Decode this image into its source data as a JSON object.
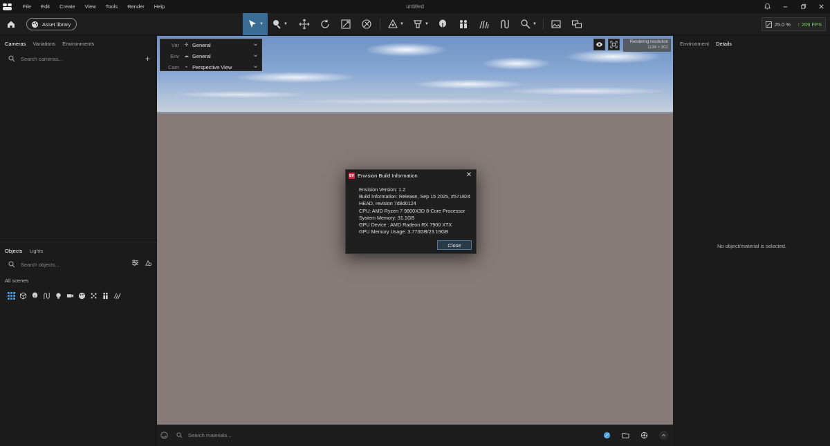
{
  "window": {
    "title": "untitled"
  },
  "menu": [
    "File",
    "Edit",
    "Create",
    "View",
    "Tools",
    "Render",
    "Help"
  ],
  "toolbar": {
    "asset_library_label": "Asset library",
    "zoom": "25.0 %",
    "fps": "209 FPS"
  },
  "left_panel": {
    "tabs": [
      "Cameras",
      "Variations",
      "Environments"
    ],
    "camera_search_placeholder": "Search cameras...",
    "object_tabs": [
      "Objects",
      "Lights"
    ],
    "object_search_placeholder": "Search objects...",
    "all_scenes_label": "All scenes"
  },
  "viewport": {
    "overlay": [
      {
        "key": "Var",
        "value": "General"
      },
      {
        "key": "Env",
        "value": "General"
      },
      {
        "key": "Cam",
        "value": "Perspective View"
      }
    ],
    "rendering_resolution_label": "Rendering resolution",
    "rendering_resolution_value": "1134 × 902"
  },
  "dialog": {
    "title": "Envision Build Information",
    "lines": [
      "Envision Version: 1.2",
      "Build Information: Release, Sep 15 2025, #571824",
      "HEAD, revision 7d8d0124",
      "CPU: AMD Ryzen 7 9800X3D 8-Core Processor",
      "System Memory: 31.1GB",
      "GPU Device : AMD Radeon RX 7900 XTX",
      "GPU Memory Usage: 3.773GB/23.19GB"
    ],
    "close_label": "Close"
  },
  "material_bar": {
    "search_placeholder": "Search materials..."
  },
  "right_panel": {
    "tabs": [
      "Environment",
      "Details"
    ],
    "empty_message": "No object/material is selected."
  },
  "colors": {
    "accent": "#3a6d96",
    "fps_green": "#7bd05a",
    "brand_red": "#c6324a"
  }
}
